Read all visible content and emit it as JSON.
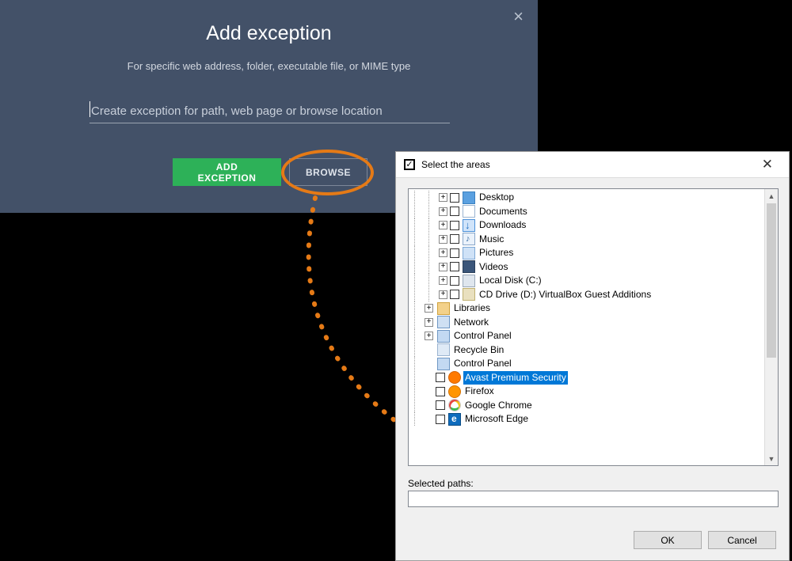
{
  "modal": {
    "title": "Add exception",
    "subtitle": "For specific web address, folder, executable file, or MIME type",
    "input_placeholder": "Create exception for path, web page or browse location",
    "add_button": "ADD EXCEPTION",
    "browse_button": "BROWSE"
  },
  "dialog": {
    "title": "Select the areas",
    "selected_paths_label": "Selected paths:",
    "ok": "OK",
    "cancel": "Cancel",
    "tree": [
      {
        "indent": 2,
        "expander": "+",
        "checkbox": true,
        "icon": "b-desktop",
        "label": "Desktop"
      },
      {
        "indent": 2,
        "expander": "+",
        "checkbox": true,
        "icon": "b-doc",
        "label": "Documents"
      },
      {
        "indent": 2,
        "expander": "+",
        "checkbox": true,
        "icon": "b-down",
        "label": "Downloads"
      },
      {
        "indent": 2,
        "expander": "+",
        "checkbox": true,
        "icon": "b-music",
        "label": "Music"
      },
      {
        "indent": 2,
        "expander": "+",
        "checkbox": true,
        "icon": "b-pic",
        "label": "Pictures"
      },
      {
        "indent": 2,
        "expander": "+",
        "checkbox": true,
        "icon": "b-vid",
        "label": "Videos"
      },
      {
        "indent": 2,
        "expander": "+",
        "checkbox": true,
        "icon": "b-disk",
        "label": "Local Disk (C:)"
      },
      {
        "indent": 2,
        "expander": "+",
        "checkbox": true,
        "icon": "b-cd",
        "label": "CD Drive (D:) VirtualBox Guest Additions"
      },
      {
        "indent": 1,
        "expander": "+",
        "checkbox": false,
        "icon": "b-lib",
        "label": "Libraries"
      },
      {
        "indent": 1,
        "expander": "+",
        "checkbox": false,
        "icon": "b-net",
        "label": "Network"
      },
      {
        "indent": 1,
        "expander": "+",
        "checkbox": false,
        "icon": "b-cp",
        "label": "Control Panel"
      },
      {
        "indent": 1,
        "expander": "",
        "checkbox": false,
        "icon": "b-rec",
        "label": "Recycle Bin"
      },
      {
        "indent": 1,
        "expander": "",
        "checkbox": false,
        "icon": "b-cp",
        "label": "Control Panel"
      },
      {
        "indent": 1,
        "expander": "",
        "checkbox": true,
        "icon": "b-avast",
        "label": "Avast Premium Security",
        "selected": true
      },
      {
        "indent": 1,
        "expander": "",
        "checkbox": true,
        "icon": "b-ff",
        "label": "Firefox"
      },
      {
        "indent": 1,
        "expander": "",
        "checkbox": true,
        "icon": "b-gc",
        "label": "Google Chrome"
      },
      {
        "indent": 1,
        "expander": "",
        "checkbox": true,
        "icon": "b-edge",
        "label": "Microsoft Edge"
      }
    ]
  },
  "colors": {
    "accent_green": "#2db158",
    "highlight_orange": "#e57a16",
    "selection_blue": "#0078d7",
    "panel_bg": "#435168"
  }
}
